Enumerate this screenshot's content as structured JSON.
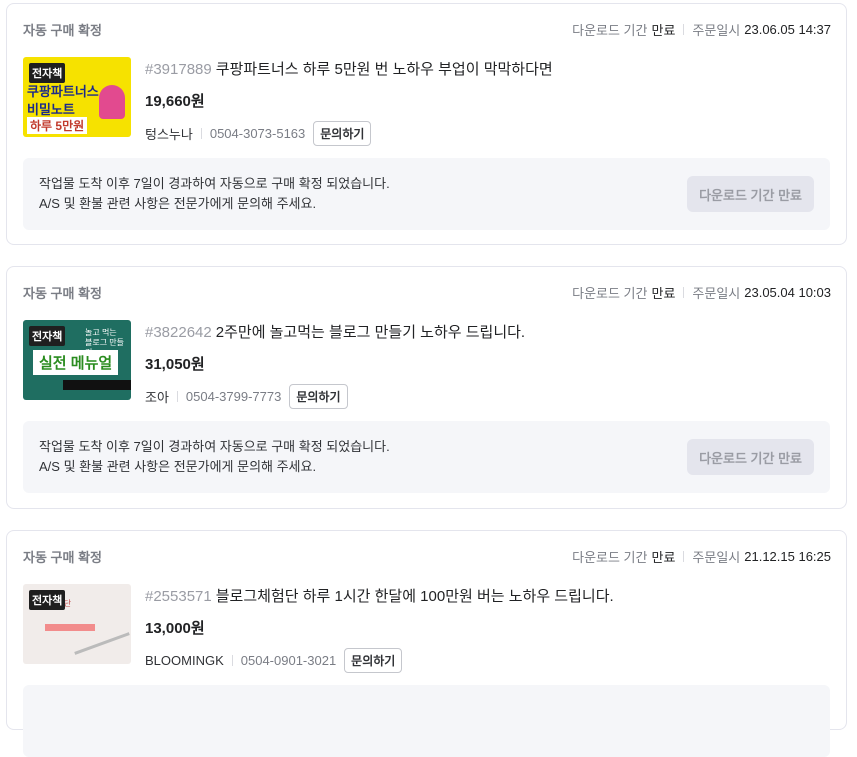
{
  "orders": [
    {
      "status": "자동 구매 확정",
      "download_label": "다운로드 기간",
      "download_value": "만료",
      "order_date_label": "주문일시",
      "order_date_value": "23.06.05 14:37",
      "gig_number": "#3917889",
      "title": "쿠팡파트너스 하루 5만원 번 노하우 부업이 막막하다면",
      "price": "19,660원",
      "seller": "텅스누나",
      "phone": "0504-3073-5163",
      "ask_button": "문의하기",
      "thumb_tag": "전자책",
      "thumb_lines": [
        "쿠팡파트너스",
        "비밀노트",
        "하루 5만원"
      ],
      "notice_line1": "작업물 도착 이후 7일이 경과하여 자동으로 구매 확정 되었습니다.",
      "notice_line2": "A/S 및 환불 관련 사항은 전문가에게 문의해 주세요.",
      "expired_button": "다운로드 기간 만료"
    },
    {
      "status": "자동 구매 확정",
      "download_label": "다운로드 기간",
      "download_value": "만료",
      "order_date_label": "주문일시",
      "order_date_value": "23.05.04 10:03",
      "gig_number": "#3822642",
      "title": "2주만에 놀고먹는 블로그 만들기 노하우 드립니다.",
      "price": "31,050원",
      "seller": "조아",
      "phone": "0504-3799-7773",
      "ask_button": "문의하기",
      "thumb_tag": "전자책",
      "thumb_lines": [
        "실전 메뉴얼"
      ],
      "notice_line1": "작업물 도착 이후 7일이 경과하여 자동으로 구매 확정 되었습니다.",
      "notice_line2": "A/S 및 환불 관련 사항은 전문가에게 문의해 주세요.",
      "expired_button": "다운로드 기간 만료"
    },
    {
      "status": "자동 구매 확정",
      "download_label": "다운로드 기간",
      "download_value": "만료",
      "order_date_label": "주문일시",
      "order_date_value": "21.12.15 16:25",
      "gig_number": "#2553571",
      "title": "블로그체험단 하루 1시간 한달에 100만원 버는 노하우 드립니다.",
      "price": "13,000원",
      "seller": "BLOOMINGK",
      "phone": "0504-0901-3021",
      "ask_button": "문의하기",
      "thumb_tag": "전자책",
      "thumb_lines": [
        "체험단"
      ],
      "notice_line1": "",
      "notice_line2": "",
      "expired_button": ""
    }
  ]
}
